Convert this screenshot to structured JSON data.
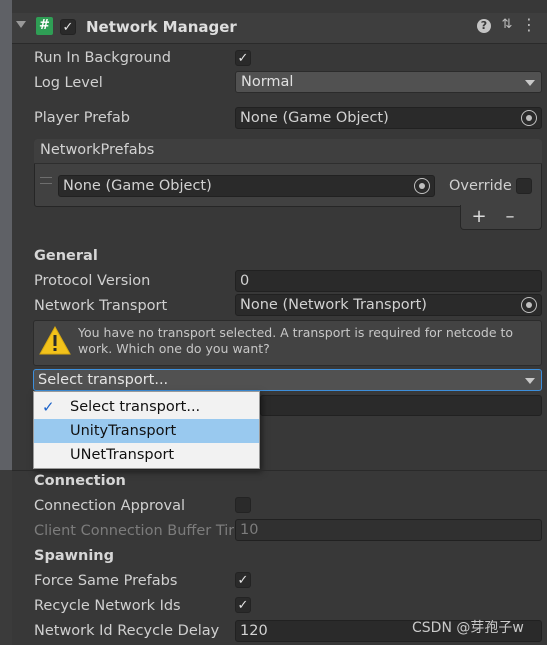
{
  "component": {
    "title": "Network Manager",
    "enabled": true,
    "icon": "hash-script-icon",
    "header_icons": [
      "help-icon",
      "preset-sliders-icon",
      "kebab-menu-icon"
    ]
  },
  "fields": {
    "run_in_background": {
      "label": "Run In Background",
      "checked": true
    },
    "log_level": {
      "label": "Log Level",
      "value": "Normal"
    },
    "player_prefab": {
      "label": "Player Prefab",
      "value": "None (Game Object)"
    }
  },
  "network_prefabs": {
    "header": "NetworkPrefabs",
    "item_value": "None (Game Object)",
    "override_label": "Override",
    "add_label": "+",
    "remove_label": "–"
  },
  "general": {
    "section": "General",
    "protocol_version": {
      "label": "Protocol Version",
      "value": "0"
    },
    "network_transport": {
      "label": "Network Transport",
      "value": "None (Network Transport)"
    },
    "warning": "You have no transport selected. A transport is required for netcode to work. Which one do you want?",
    "select_transport": "Select transport..."
  },
  "transport_menu": {
    "items": [
      {
        "label": "Select transport...",
        "checked": true
      },
      {
        "label": "UnityTransport",
        "highlighted": true
      },
      {
        "label": "UNetTransport"
      }
    ]
  },
  "connection": {
    "section": "Connection",
    "approval": {
      "label": "Connection Approval",
      "checked": false
    },
    "buffer": {
      "label": "Client Connection Buffer Tir",
      "value": "10"
    }
  },
  "spawning": {
    "section": "Spawning",
    "force_same_prefabs": {
      "label": "Force Same Prefabs",
      "checked": true
    },
    "recycle_ids": {
      "label": "Recycle Network Ids",
      "checked": true
    },
    "recycle_delay": {
      "label": "Network Id Recycle Delay",
      "value": "120"
    }
  },
  "watermark": "CSDN @芽孢子w",
  "colors": {
    "accent": "#3d8fdb",
    "menu_highlight": "#99c9ef",
    "script_icon": "#2f9e55",
    "check": "#1d63c9"
  }
}
